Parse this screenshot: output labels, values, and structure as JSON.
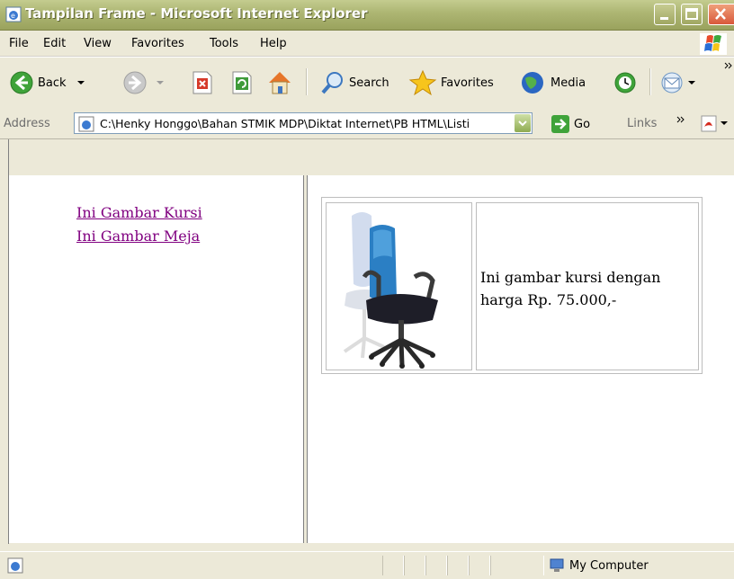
{
  "window": {
    "title": "Tampilan Frame - Microsoft Internet Explorer"
  },
  "menu": [
    "File",
    "Edit",
    "View",
    "Favorites",
    "Tools",
    "Help"
  ],
  "toolbar": {
    "back_label": "Back",
    "search_label": "Search",
    "favorites_label": "Favorites",
    "media_label": "Media"
  },
  "address": {
    "label": "Address",
    "value": "C:\\Henky Honggo\\Bahan STMIK MDP\\Diktat Internet\\PB HTML\\Listi",
    "go_label": "Go",
    "links_label": "Links"
  },
  "nav_frame": {
    "links": [
      "Ini Gambar Kursi",
      "Ini Gambar Meja"
    ]
  },
  "product": {
    "description": "Ini gambar kursi dengan harga Rp. 75.000,-"
  },
  "status": {
    "zone": "My Computer"
  }
}
